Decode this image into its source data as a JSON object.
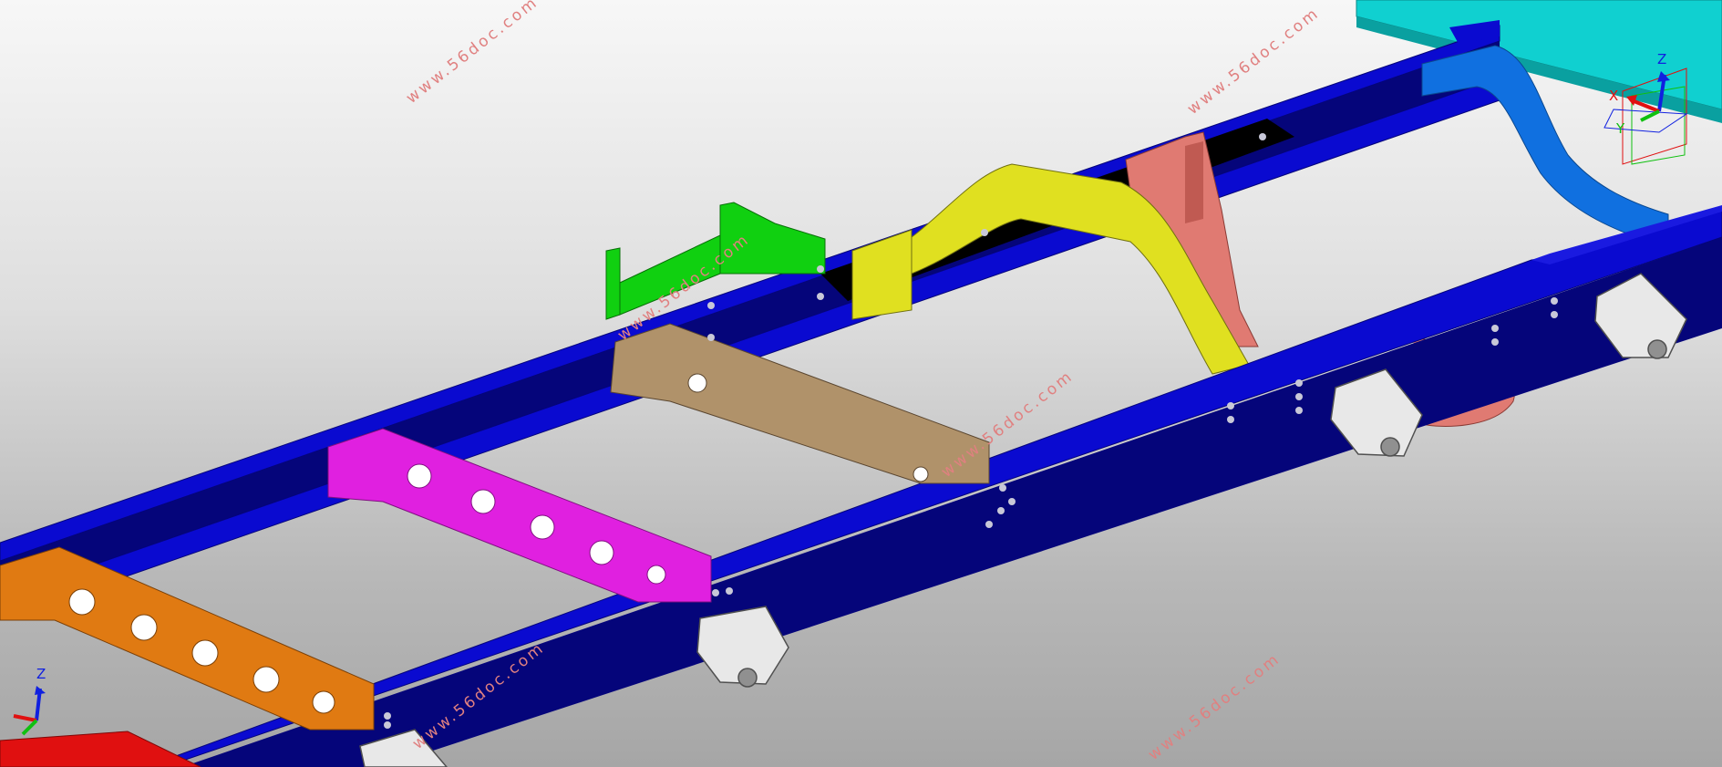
{
  "viewport": {
    "background_top": "#f7f7f7",
    "background_bottom": "#a6a6a6"
  },
  "colors": {
    "rail": "#0a0ad0",
    "rail_dark": "#05057a",
    "rail_web": "#060690",
    "crossmember_orange": "#e07a12",
    "crossmember_magenta": "#e020e0",
    "crossmember_tan": "#b0926a",
    "crossmember_yellow": "#e0e020",
    "crossmember_blue": "#1070e0",
    "bracket_green": "#10d010",
    "bracket_salmon": "#e07a72",
    "bracket_cyan": "#10d0d0",
    "hanger_white": "#e8e8e8",
    "part_red": "#e01010",
    "watermark": "#e08080"
  },
  "watermark": {
    "text": "www.56doc.com"
  },
  "triad_main": {
    "x_label": "X",
    "y_label": "Y",
    "z_label": "Z",
    "x_color": "#e01010",
    "y_color": "#10c010",
    "z_color": "#1020e0"
  },
  "triad_corner": {
    "z_label": "Z"
  }
}
